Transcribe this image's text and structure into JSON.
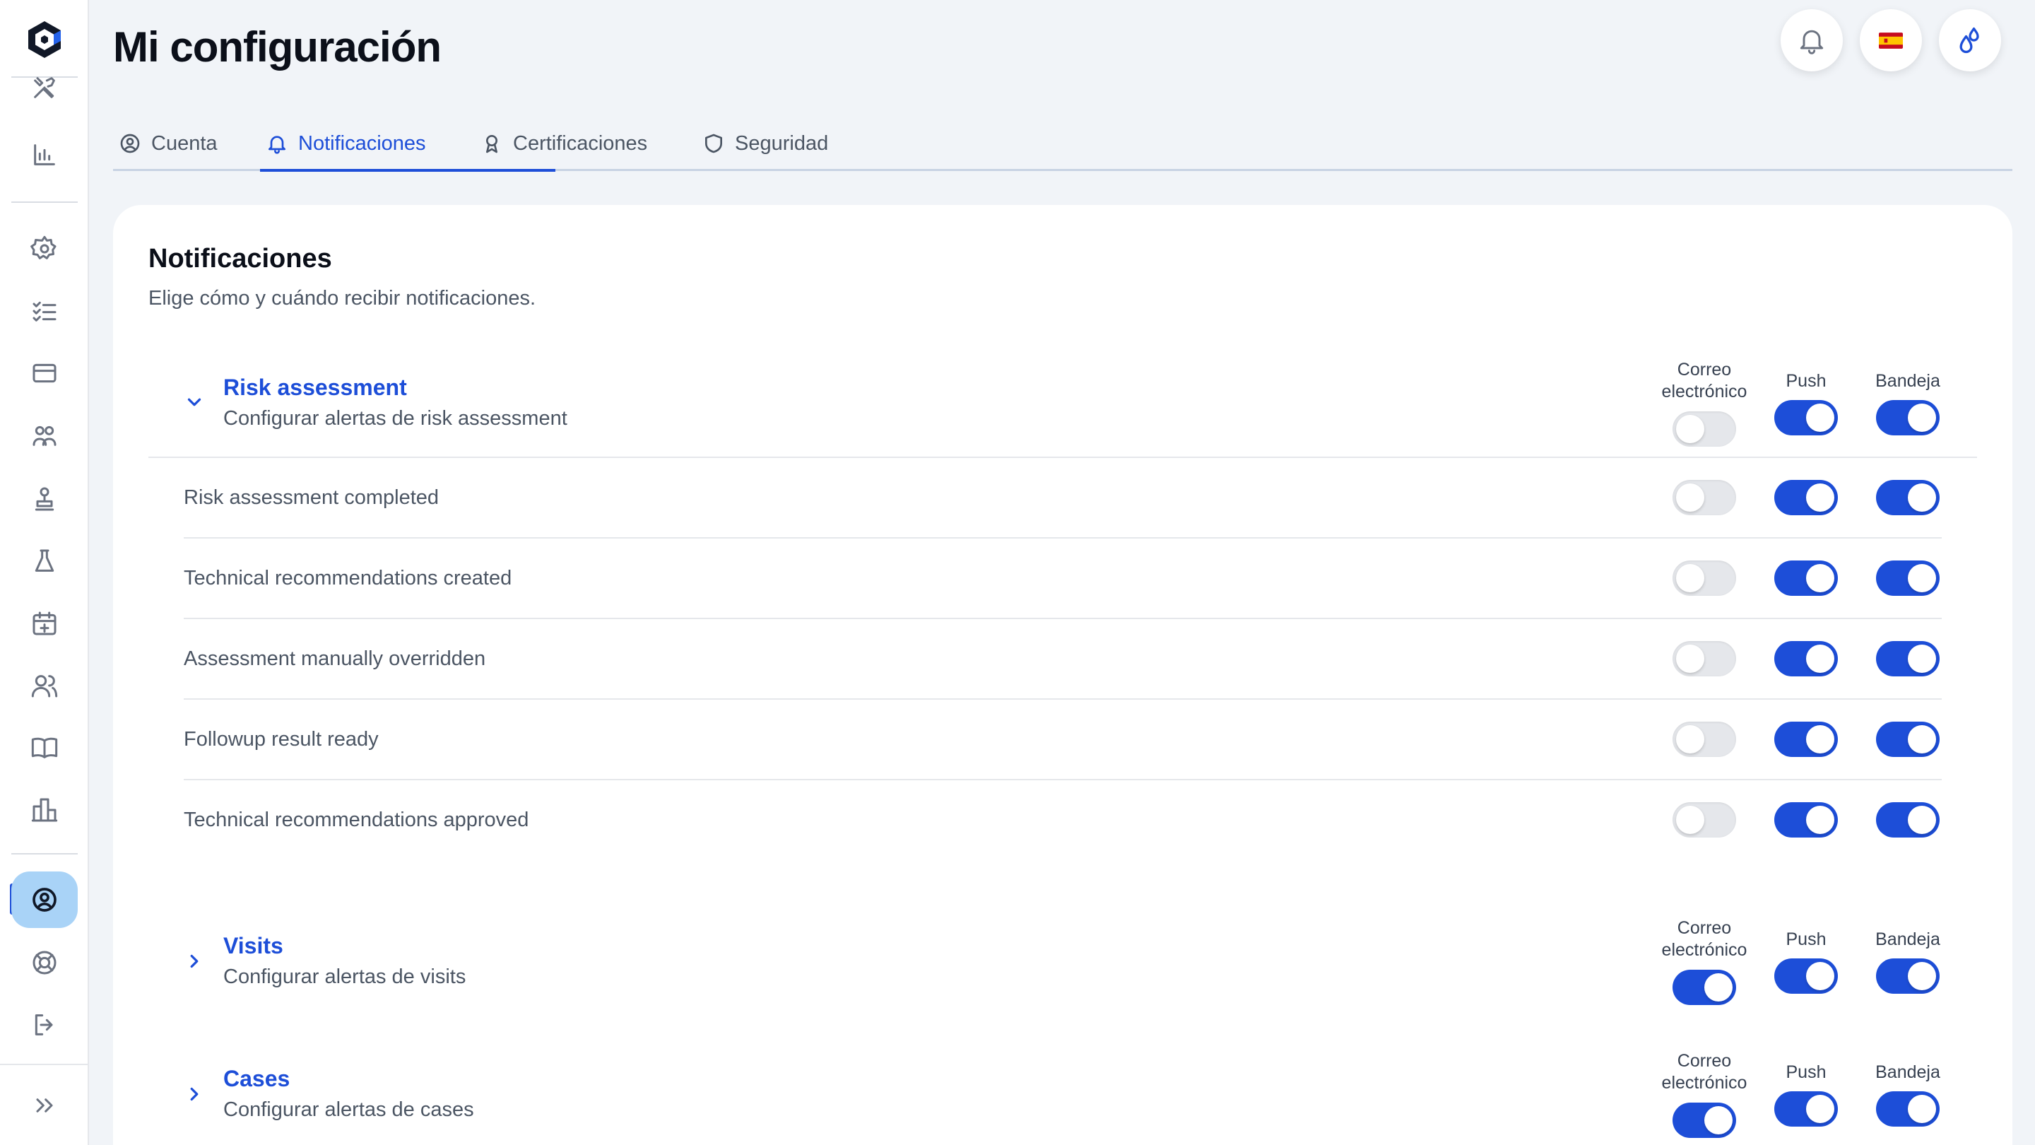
{
  "page": {
    "title": "Mi configuración"
  },
  "header": {
    "language_flag": "🇪🇸",
    "icons": [
      "bell-icon",
      "flag-es-icon",
      "theme-drops-icon"
    ]
  },
  "tabs": [
    {
      "label": "Cuenta",
      "icon": "user-circle-icon",
      "active": false
    },
    {
      "label": "Notificaciones",
      "icon": "bell-icon",
      "active": true
    },
    {
      "label": "Certificaciones",
      "icon": "award-icon",
      "active": false
    },
    {
      "label": "Seguridad",
      "icon": "shield-icon",
      "active": false
    }
  ],
  "card": {
    "title": "Notificaciones",
    "subtitle": "Elige cómo y cuándo recibir notificaciones."
  },
  "columns": {
    "email": "Correo electrónico",
    "push": "Push",
    "tray": "Bandeja"
  },
  "groups": [
    {
      "name": "Risk assessment",
      "description": "Configurar alertas de risk assessment",
      "expanded": true,
      "toggles": {
        "email": false,
        "push": true,
        "tray": true
      },
      "items": [
        {
          "label": "Risk assessment completed",
          "email": false,
          "push": true,
          "tray": true
        },
        {
          "label": "Technical recommendations created",
          "email": false,
          "push": true,
          "tray": true
        },
        {
          "label": "Assessment manually overridden",
          "email": false,
          "push": true,
          "tray": true
        },
        {
          "label": "Followup result ready",
          "email": false,
          "push": true,
          "tray": true
        },
        {
          "label": "Technical recommendations approved",
          "email": false,
          "push": true,
          "tray": true
        }
      ]
    },
    {
      "name": "Visits",
      "description": "Configurar alertas de visits",
      "expanded": false,
      "toggles": {
        "email": true,
        "push": true,
        "tray": true
      }
    },
    {
      "name": "Cases",
      "description": "Configurar alertas de cases",
      "expanded": false,
      "toggles": {
        "email": true,
        "push": true,
        "tray": true
      }
    }
  ],
  "colors": {
    "accent": "#1d4ed8",
    "toggle_off": "#e5e7eb",
    "sidebar_active": "#a9d3f7"
  },
  "sidebar": {
    "items": [
      "tools-icon",
      "bar-chart-icon",
      "settings-icon",
      "checklist-icon",
      "card-icon",
      "team-icon",
      "stamp-icon",
      "flask-icon",
      "calendar-plus-icon",
      "users-icon",
      "book-icon",
      "buildings-icon",
      "user-circle-icon",
      "lifebuoy-icon",
      "logout-icon",
      "expand-icon"
    ],
    "active": "user-circle-icon"
  }
}
